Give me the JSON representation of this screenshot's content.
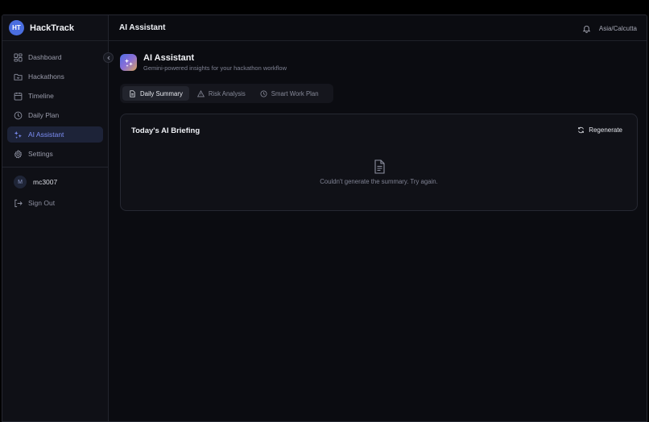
{
  "brand": {
    "initials": "HT",
    "name": "HackTrack"
  },
  "sidebar": {
    "items": [
      {
        "label": "Dashboard",
        "icon": "dashboard-icon",
        "active": false
      },
      {
        "label": "Hackathons",
        "icon": "folder-icon",
        "active": false
      },
      {
        "label": "Timeline",
        "icon": "calendar-icon",
        "active": false
      },
      {
        "label": "Daily Plan",
        "icon": "clock-icon",
        "active": false
      },
      {
        "label": "AI Assistant",
        "icon": "sparkles-icon",
        "active": true
      },
      {
        "label": "Settings",
        "icon": "gear-icon",
        "active": false
      }
    ],
    "user": {
      "initial": "M",
      "name": "mc3007"
    },
    "signout_label": "Sign Out"
  },
  "topbar": {
    "title": "AI Assistant",
    "timezone": "Asia/Calcutta"
  },
  "header": {
    "title": "AI Assistant",
    "subtitle": "Gemini-powered insights for your hackathon workflow"
  },
  "tabs": [
    {
      "label": "Daily Summary",
      "icon": "document-icon",
      "active": true
    },
    {
      "label": "Risk Analysis",
      "icon": "warning-icon",
      "active": false
    },
    {
      "label": "Smart Work Plan",
      "icon": "clock-icon",
      "active": false
    }
  ],
  "card": {
    "title": "Today's AI Briefing",
    "regenerate_label": "Regenerate",
    "empty_message": "Couldn't generate the summary. Try again."
  },
  "colors": {
    "accent": "#7c8ef5",
    "brand": "#4a6ee0",
    "background": "#0b0c11"
  }
}
